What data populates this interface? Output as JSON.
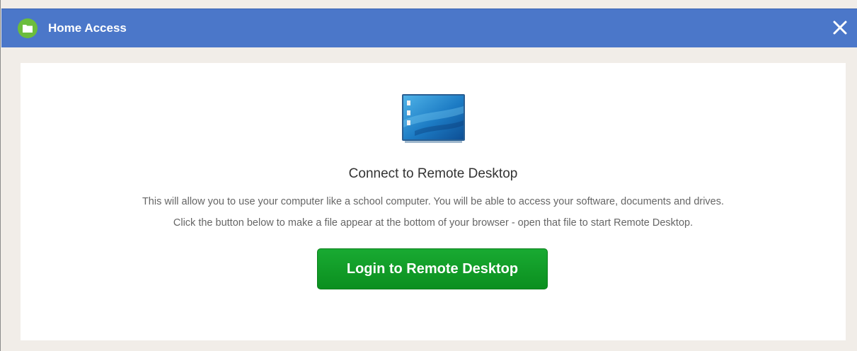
{
  "dialog": {
    "title": "Home Access",
    "close_label": "×"
  },
  "icons": {
    "app": "folder-icon",
    "close": "close-icon",
    "illustration": "remote-desktop-monitor-icon"
  },
  "content": {
    "heading": "Connect to Remote Desktop",
    "description_line1": "This will allow you to use your computer like a school computer. You will be able to access your software, documents and drives.",
    "description_line2": "Click the button below to make a file appear at the bottom of your browser - open that file to start Remote Desktop.",
    "button_label": "Login to Remote Desktop"
  },
  "colors": {
    "titlebar": "#4b77c9",
    "app_icon": "#6bbd3c",
    "button": "#11a02a"
  }
}
